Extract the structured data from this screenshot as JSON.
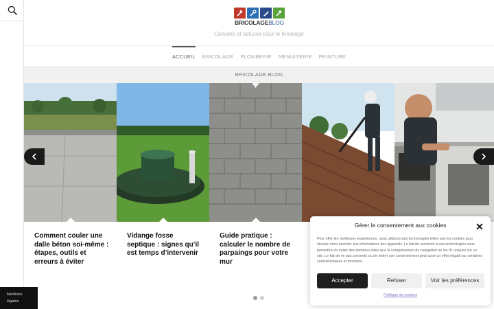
{
  "site": {
    "logo_text_bold": "BRICOLAGE",
    "logo_text_light": "BLOG",
    "tagline": "Conseils et astuces pour le bricolage"
  },
  "nav": {
    "items": [
      {
        "label": "ACCUEIL",
        "active": true
      },
      {
        "label": "BRICOLAGE",
        "active": false
      },
      {
        "label": "PLOMBERIE",
        "active": false
      },
      {
        "label": "MENUISERIE",
        "active": false
      },
      {
        "label": "PEINTURE",
        "active": false
      }
    ]
  },
  "band": {
    "label": "BRICOLAGE BLOG"
  },
  "slider": {
    "cards": [
      {
        "title": "Comment couler une dalle béton soi-même : étapes, outils et erreurs à éviter",
        "image": "concrete-slab-photo"
      },
      {
        "title": "Vidange fosse septique : signes qu’il est temps d’intervenir",
        "image": "septic-tank-photo"
      },
      {
        "title": "Guide pratique : calculer le nombre de parpaings pour votre mur",
        "image": "block-wall-photo"
      },
      {
        "title": "",
        "image": "roof-worker-photo"
      },
      {
        "title": "",
        "image": "kitchen-oven-photo"
      }
    ],
    "prev_icon": "chevron-left-icon",
    "next_icon": "chevron-right-icon",
    "dots": [
      true,
      false
    ]
  },
  "legal": {
    "line1": "Mentions",
    "line2": "légales"
  },
  "cookie": {
    "title": "Gérer le consentement aux cookies",
    "text": "Pour offrir les meilleures expériences, nous utilisons des technologies telles que les cookies pour stocker et/ou accéder aux informations des appareils. Le fait de consentir à ces technologies nous permettra de traiter des données telles que le comportement de navigation ou les ID uniques sur ce site. Le fait de ne pas consentir ou de retirer son consentement peut avoir un effet négatif sur certaines caractéristiques et fonctions.",
    "accept": "Accepter",
    "refuse": "Refuser",
    "prefs": "Voir les préférences",
    "policy": "Politique de cookies"
  },
  "colors": {
    "dark": "#1a1a1a",
    "logo_red": "#c0392b",
    "logo_blue": "#2c6fb7",
    "logo_navy": "#2b4a8c",
    "logo_green": "#5aa33a",
    "link": "#7b7bc8"
  }
}
